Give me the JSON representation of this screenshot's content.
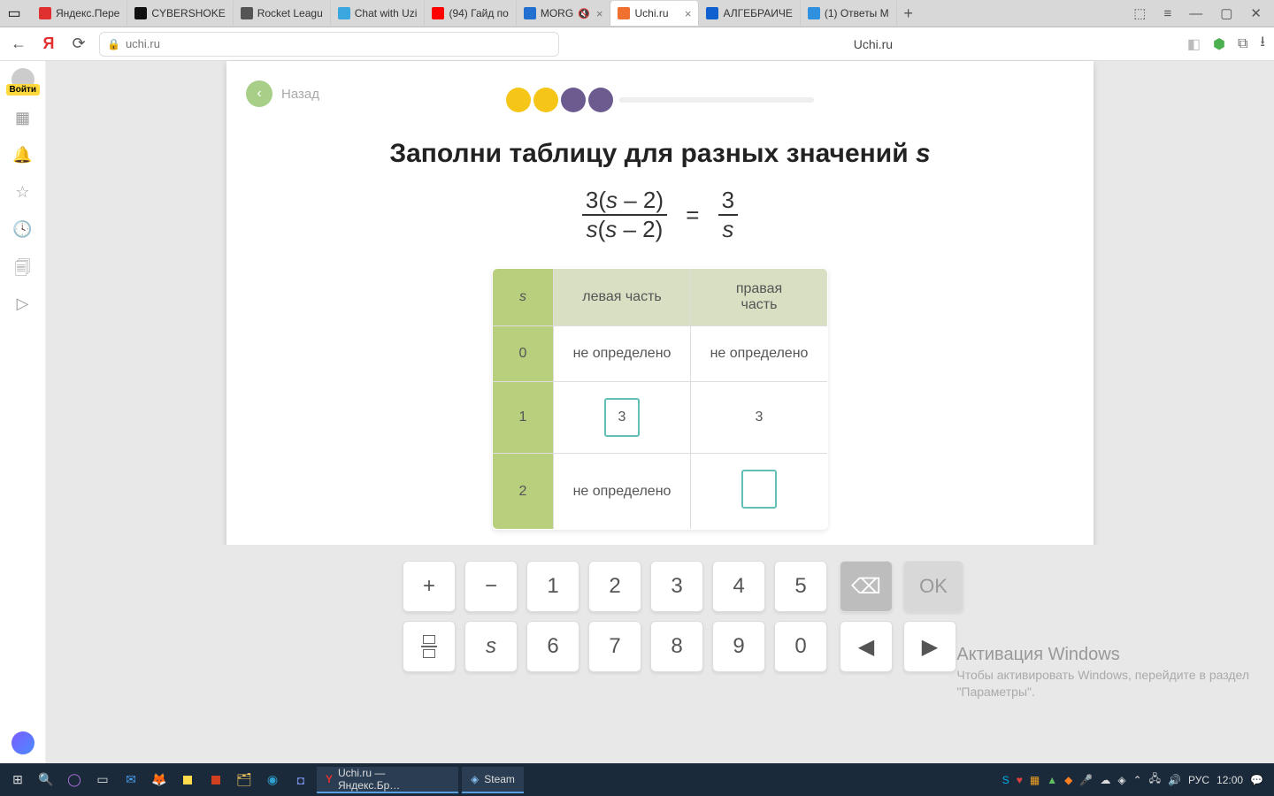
{
  "browser": {
    "tabs": [
      {
        "title": "Яндекс.Пере",
        "icon_bg": "#e03030"
      },
      {
        "title": "CYBERSHOKE",
        "icon_bg": "#111"
      },
      {
        "title": "Rocket Leagu",
        "icon_bg": "#555"
      },
      {
        "title": "Chat with Uzi",
        "icon_bg": "#3aa7e0"
      },
      {
        "title": "(94) Гайд по",
        "icon_bg": "#ff0000"
      },
      {
        "title": "MORG",
        "icon_bg": "#2270d0",
        "muted": true,
        "closeable": true
      },
      {
        "title": "Uchi.ru",
        "icon_bg": "#f07030",
        "active": true,
        "closeable": true
      },
      {
        "title": "АЛГЕБРАИЧЕ",
        "icon_bg": "#1060d0"
      },
      {
        "title": "(1) Ответы M",
        "icon_bg": "#3090e0"
      }
    ],
    "address": "uchi.ru",
    "page_title": "Uchi.ru"
  },
  "sidebar": {
    "login": "Войти"
  },
  "lesson": {
    "back": "Назад",
    "heading_main": "Заполни таблицу для разных значений ",
    "heading_var": "s",
    "formula": {
      "left_num": "3(s – 2)",
      "left_den": "s(s – 2)",
      "right_num": "3",
      "right_den": "s"
    },
    "table": {
      "corner": "s",
      "col1": "левая часть",
      "col2": "правая часть",
      "rows": [
        {
          "s": "0",
          "left": "не определено",
          "right": "не определено"
        },
        {
          "s": "1",
          "left_input": "3",
          "right": "3"
        },
        {
          "s": "2",
          "left": "не определено",
          "right_input": ""
        }
      ]
    }
  },
  "keypad": {
    "keys_row1": [
      "+",
      "−",
      "1",
      "2",
      "3",
      "4",
      "5"
    ],
    "keys_row2": [
      "frac",
      "s",
      "6",
      "7",
      "8",
      "9",
      "0"
    ],
    "ok": "OK",
    "arrows": [
      "◀",
      "▶"
    ]
  },
  "watermark": {
    "l1": "Активация Windows",
    "l2": "Чтобы активировать Windows, перейдите в раздел",
    "l3": "\"Параметры\"."
  },
  "taskbar": {
    "app1": "Uchi.ru — Яндекс.Бр…",
    "app2": "Steam",
    "lang": "РУС",
    "time": "12:00"
  }
}
